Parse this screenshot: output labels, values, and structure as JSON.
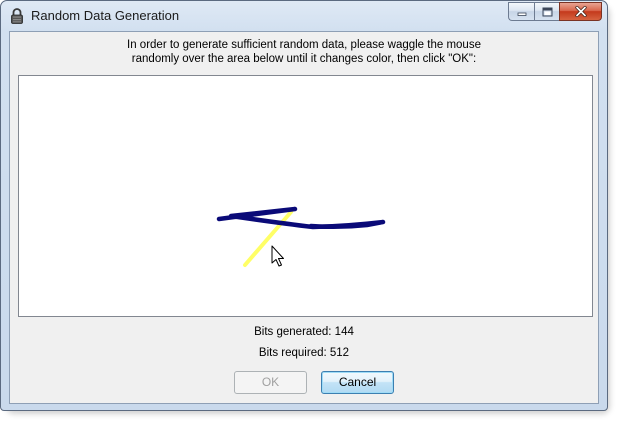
{
  "window": {
    "title": "Random Data Generation",
    "icon": "lock-icon"
  },
  "caption_buttons": {
    "minimize_icon": "minimize-icon",
    "maximize_icon": "maximize-icon",
    "close_icon": "close-icon"
  },
  "instructions": {
    "line1": "In order to generate sufficient random data, please waggle the mouse",
    "line2": "randomly over the area below until it changes color, then click \"OK\":"
  },
  "drawing_area": {
    "colors": {
      "trail": "#0a0a78",
      "highlight": "#ffff66"
    }
  },
  "stats": {
    "bits_generated": "Bits generated: 144",
    "bits_required": "Bits required: 512"
  },
  "buttons": {
    "ok_label": "OK",
    "ok_enabled": false,
    "cancel_label": "Cancel"
  }
}
